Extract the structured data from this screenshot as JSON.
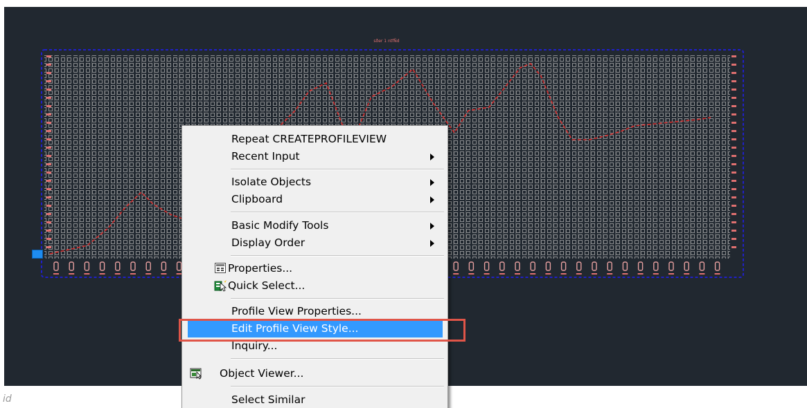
{
  "drawing": {
    "title_text": "sðer 1 ntfÑd",
    "background": "#212830",
    "frame_color": "#2020c8",
    "grid_color": "#cfcfcf",
    "profile_color": "#d42b2b",
    "label_color": "#e8a0a0"
  },
  "command_line": {
    "partial_text": "id"
  },
  "context_menu": {
    "items": [
      {
        "label": "Repeat CREATEPROFILEVIEW",
        "submenu": false
      },
      {
        "label": "Recent Input",
        "submenu": true
      },
      {
        "label": "Isolate Objects",
        "submenu": true
      },
      {
        "label": "Clipboard",
        "submenu": true
      },
      {
        "label": "Basic Modify Tools",
        "submenu": true
      },
      {
        "label": "Display Order",
        "submenu": true
      },
      {
        "label": "Properties...",
        "icon": "properties-icon",
        "submenu": false
      },
      {
        "label": "Quick Select...",
        "icon": "quick-select-icon",
        "submenu": false
      },
      {
        "label": "Profile View Properties...",
        "submenu": false
      },
      {
        "label": "Edit Profile View Style...",
        "submenu": false,
        "selected": true
      },
      {
        "label": "Inquiry...",
        "submenu": false
      },
      {
        "label": "Object Viewer...",
        "icon": "object-viewer-icon",
        "submenu": false
      },
      {
        "label": "Select Similar",
        "submenu": false
      }
    ],
    "selected_color": "#3399ff",
    "highlight_box_color": "#e05548"
  }
}
